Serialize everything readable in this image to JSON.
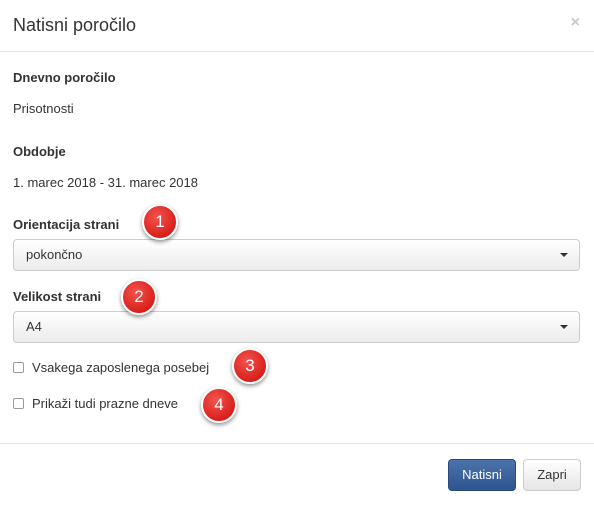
{
  "dialog": {
    "title": "Natisni poročilo",
    "close_glyph": "×"
  },
  "report": {
    "label": "Dnevno poročilo",
    "value": "Prisotnosti"
  },
  "period": {
    "label": "Obdobje",
    "value": "1. marec 2018 - 31. marec 2018"
  },
  "orientation": {
    "label": "Orientacija strani",
    "selected": "pokončno"
  },
  "page_size": {
    "label": "Velikost strani",
    "selected": "A4"
  },
  "options": [
    {
      "label": "Vsakega zaposlenega posebej",
      "checked": false
    },
    {
      "label": "Prikaži tudi prazne dneve",
      "checked": false
    }
  ],
  "badges": [
    "1",
    "2",
    "3",
    "4"
  ],
  "footer": {
    "print_label": "Natisni",
    "close_label": "Zapri"
  },
  "colors": {
    "primary": "#3b5f9a",
    "badge": "#e0302b"
  }
}
